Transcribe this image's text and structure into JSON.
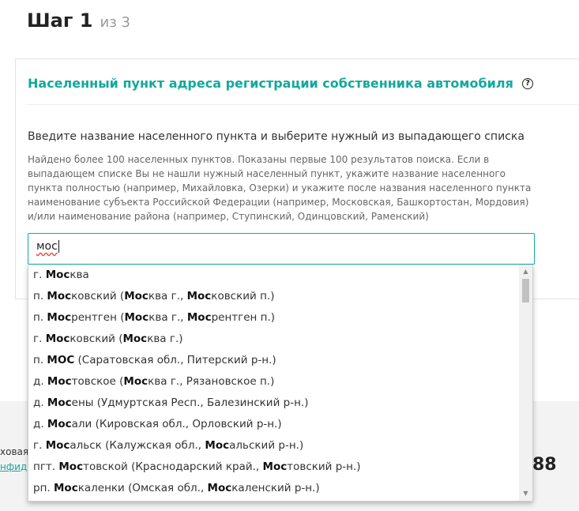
{
  "step": {
    "title": "Шаг 1",
    "of": "из 3"
  },
  "card": {
    "title": "Населенный пункт адреса регистрации собственника автомобиля",
    "help": "?",
    "instruction": "Введите название населенного пункта и выберите нужный из выпадающего списка",
    "hint": "Найдено более 100 населенных пунктов. Показаны первые 100 результатов поиска. Если в выпадающем списке Вы не нашли нужный населенный пункт, укажите название населенного пункта полностью (например, Михайловка, Озерки) и укажите после названия населенного пункта наименование субъекта Российской Федерации (например, Московская, Башкортостан, Мордовия) и/или наименование района (например, Ступинский, Одинцовский, Раменский)"
  },
  "search": {
    "value": "мос"
  },
  "dropdown": {
    "items": [
      {
        "segments": [
          {
            "t": "г. ",
            "b": false
          },
          {
            "t": "Мос",
            "b": true
          },
          {
            "t": "ква",
            "b": false
          }
        ]
      },
      {
        "segments": [
          {
            "t": "п. ",
            "b": false
          },
          {
            "t": "Мос",
            "b": true
          },
          {
            "t": "ковский (",
            "b": false
          },
          {
            "t": "Мос",
            "b": true
          },
          {
            "t": "ква г., ",
            "b": false
          },
          {
            "t": "Мос",
            "b": true
          },
          {
            "t": "ковский п.)",
            "b": false
          }
        ]
      },
      {
        "segments": [
          {
            "t": "п. ",
            "b": false
          },
          {
            "t": "Мос",
            "b": true
          },
          {
            "t": "рентген (",
            "b": false
          },
          {
            "t": "Мос",
            "b": true
          },
          {
            "t": "ква г., ",
            "b": false
          },
          {
            "t": "Мос",
            "b": true
          },
          {
            "t": "рентген п.)",
            "b": false
          }
        ]
      },
      {
        "segments": [
          {
            "t": "г. ",
            "b": false
          },
          {
            "t": "Мос",
            "b": true
          },
          {
            "t": "ковский (",
            "b": false
          },
          {
            "t": "Мос",
            "b": true
          },
          {
            "t": "ква г.)",
            "b": false
          }
        ]
      },
      {
        "segments": [
          {
            "t": "п. ",
            "b": false
          },
          {
            "t": "МОС",
            "b": true
          },
          {
            "t": " (Саратовская обл., Питерский р-н.)",
            "b": false
          }
        ]
      },
      {
        "segments": [
          {
            "t": "д. ",
            "b": false
          },
          {
            "t": "Мос",
            "b": true
          },
          {
            "t": "товское (",
            "b": false
          },
          {
            "t": "Мос",
            "b": true
          },
          {
            "t": "ква г., Рязановское п.)",
            "b": false
          }
        ]
      },
      {
        "segments": [
          {
            "t": "д. ",
            "b": false
          },
          {
            "t": "Мос",
            "b": true
          },
          {
            "t": "ены (Удмуртская Респ., Балезинский р-н.)",
            "b": false
          }
        ]
      },
      {
        "segments": [
          {
            "t": "д. ",
            "b": false
          },
          {
            "t": "Мос",
            "b": true
          },
          {
            "t": "али (Кировская обл., Орловский р-н.)",
            "b": false
          }
        ]
      },
      {
        "segments": [
          {
            "t": "г. ",
            "b": false
          },
          {
            "t": "Мос",
            "b": true
          },
          {
            "t": "альск (Калужская обл., ",
            "b": false
          },
          {
            "t": "Мос",
            "b": true
          },
          {
            "t": "альский р-н.)",
            "b": false
          }
        ]
      },
      {
        "segments": [
          {
            "t": "пгт. ",
            "b": false
          },
          {
            "t": "Мос",
            "b": true
          },
          {
            "t": "товской (Краснодарский край., ",
            "b": false
          },
          {
            "t": "Мос",
            "b": true
          },
          {
            "t": "товский р-н.)",
            "b": false
          }
        ]
      },
      {
        "segments": [
          {
            "t": "рп. ",
            "b": false
          },
          {
            "t": "Мос",
            "b": true
          },
          {
            "t": "каленки (Омская обл., ",
            "b": false
          },
          {
            "t": "Мос",
            "b": true
          },
          {
            "t": "каленский р-н.)",
            "b": false
          }
        ]
      }
    ]
  },
  "footer": {
    "line1": "ховая",
    "line2": "нфид",
    "number": "88"
  },
  "colors": {
    "accent": "#13a89e",
    "footer_bg": "#f3f3f3"
  }
}
